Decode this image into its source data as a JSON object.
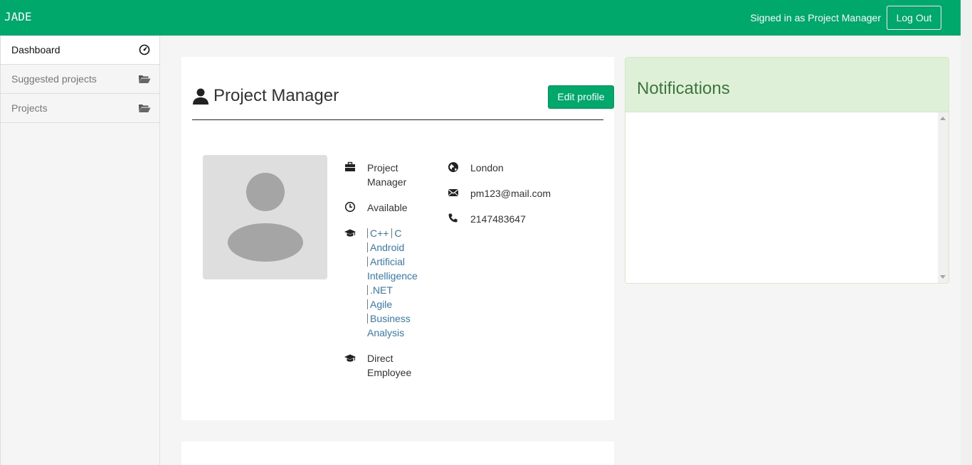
{
  "app": {
    "brand": "JADE"
  },
  "header": {
    "signed_in_text": "Signed in as Project Manager",
    "logout_label": "Log Out"
  },
  "sidebar": {
    "items": [
      {
        "label": "Dashboard",
        "icon": "dashboard-icon",
        "active": true
      },
      {
        "label": "Suggested projects",
        "icon": "folder-open-icon",
        "active": false
      },
      {
        "label": "Projects",
        "icon": "folder-open-icon",
        "active": false
      }
    ]
  },
  "profile": {
    "name": "Project Manager",
    "edit_label": "Edit profile",
    "role_line1": "Project",
    "role_line2": "Manager",
    "status": "Available",
    "skills": [
      "C++",
      "C",
      "Android",
      "Artificial Intelligence",
      ".NET",
      "Agile",
      "Business Analysis"
    ],
    "employment_line1": "Direct",
    "employment_line2": "Employee",
    "location": "London",
    "email": "pm123@mail.com",
    "phone": "2147483647"
  },
  "notifications": {
    "title": "Notifications"
  },
  "colors": {
    "brand": "#00a86b",
    "link": "#337ab7",
    "panel_success": "#dff0d8",
    "panel_success_text": "#3c763d"
  }
}
